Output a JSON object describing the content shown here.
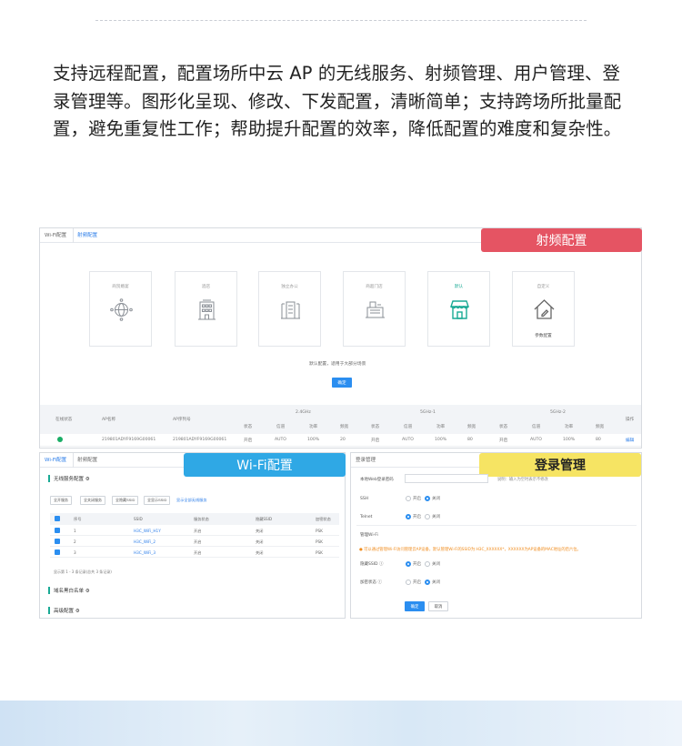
{
  "intro_text": "支持远程配置，配置场所中云 AP 的无线服务、射频管理、用户管理、登录管理等。图形化呈现、修改、下发配置，清晰简单；支持跨场所批量配置，避免重复性工作；帮助提升配置的效率，降低配置的难度和复杂性。",
  "callouts": {
    "rf": "射频配置",
    "wifi": "Wi-Fi配置",
    "login": "登录管理"
  },
  "colors": {
    "rf_callout": "#e55463",
    "wifi_callout": "#2fa8e5",
    "login_callout": "#f6e463",
    "accent": "#2b8ef0",
    "active_scene": "#1aaa95"
  },
  "rf_panel": {
    "tabs": [
      "Wi-Fi配置",
      "射频配置"
    ],
    "scenes": [
      {
        "label": "商贸婚宴",
        "icon": "network-globe-icon"
      },
      {
        "label": "酒店",
        "icon": "hotel-building-icon"
      },
      {
        "label": "独立办公",
        "icon": "office-building-icon"
      },
      {
        "label": "商超门店",
        "icon": "store-cashier-icon"
      },
      {
        "label": "默认",
        "icon": "storefront-icon",
        "active": true
      },
      {
        "label": "自定义",
        "icon": "custom-house-edit-icon",
        "sub": "参数配置"
      }
    ],
    "description": "默认配置，适用于大部分场景",
    "confirm": "确定",
    "table": {
      "col_status": "在线状态",
      "col_name": "AP名称",
      "col_serial": "AP序列号",
      "col_action": "操作",
      "band_24": "2.4GHz",
      "band_5_1": "5GHz-1",
      "band_5_2": "5GHz-2",
      "sub_headers": [
        "状态",
        "信道",
        "功率",
        "频宽"
      ],
      "row": {
        "name": "219801ADYF9169G00061",
        "serial": "219801ADYF9169G00061",
        "b24": [
          "开启",
          "AUTO",
          "100%",
          "20"
        ],
        "b51": [
          "开启",
          "AUTO",
          "100%",
          "80"
        ],
        "b52": [
          "开启",
          "AUTO",
          "100%",
          "80"
        ],
        "action": "编辑"
      }
    }
  },
  "wifi_panel": {
    "tabs": [
      "Wi-Fi配置",
      "射频配置"
    ],
    "section_service": "无线服务配置",
    "buttons": [
      "全开服务",
      "全关闭服务",
      "全隐藏SSID",
      "全显示SSID"
    ],
    "link": "显示全部无线服务",
    "columns": [
      "序号",
      "SSID",
      "服务状态",
      "隐藏SSID",
      "加密状态"
    ],
    "rows": [
      [
        "1",
        "H3C_WiFi_H1Y",
        "开启",
        "关闭",
        "PSK"
      ],
      [
        "2",
        "H3C_WiFi_2",
        "开启",
        "关闭",
        "PSK"
      ],
      [
        "3",
        "H3C_WiFi_3",
        "开启",
        "关闭",
        "PSK"
      ]
    ],
    "footer": "显示第 1 - 3 条记录(总共 3 条记录)",
    "section_whitelist": "域名黑白名单",
    "section_advanced": "高级配置"
  },
  "login_panel": {
    "title": "登录管理",
    "web_label": "本地Web登录密码",
    "web_hint": "说明：输入为空时表示不修改",
    "ssh_label": "SSH",
    "telnet_label": "Telnet",
    "on": "开启",
    "off": "关闭",
    "mgmt_title": "管理Wi-Fi",
    "warn": "可以通过管理Wi-Fi访问管理云AP设备，默认管理Wi-Fi的SSID为:H3C_XXXXXX*，XXXXXX为AP设备的MAC地址的后六位。",
    "hide_ssid_label": "隐藏SSID",
    "encrypt_label": "加密状态",
    "ok": "确定",
    "cancel": "取消"
  }
}
